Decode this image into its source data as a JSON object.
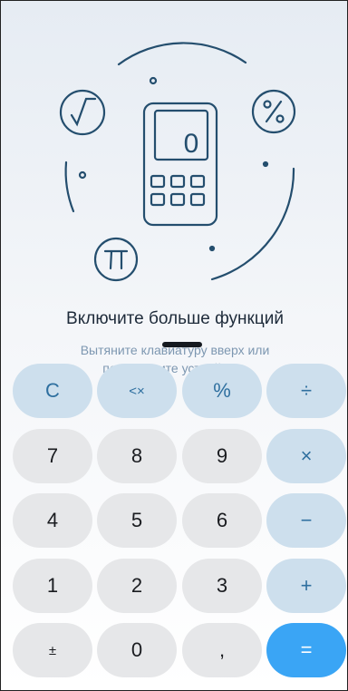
{
  "promo": {
    "title": "Включите больше функций",
    "subtitle_line1": "Вытяните клавиатуру вверх или",
    "subtitle_line2": "переверните устройство"
  },
  "illustration": {
    "display_digit": "0",
    "icons": [
      "sqrt-icon",
      "percent-icon",
      "pi-icon",
      "calculator-icon"
    ]
  },
  "keypad": {
    "rows": [
      [
        "C",
        "<×",
        "%",
        "÷"
      ],
      [
        "7",
        "8",
        "9",
        "×"
      ],
      [
        "4",
        "5",
        "6",
        "−"
      ],
      [
        "1",
        "2",
        "3",
        "+"
      ],
      [
        "±",
        "0",
        ",",
        "="
      ]
    ]
  },
  "colors": {
    "accent": "#3aa5f5",
    "function_key_bg": "#cddfed",
    "function_key_text": "#2e6f9f",
    "number_key_bg": "#e6e7e9",
    "illustration_stroke": "#244e6e"
  }
}
